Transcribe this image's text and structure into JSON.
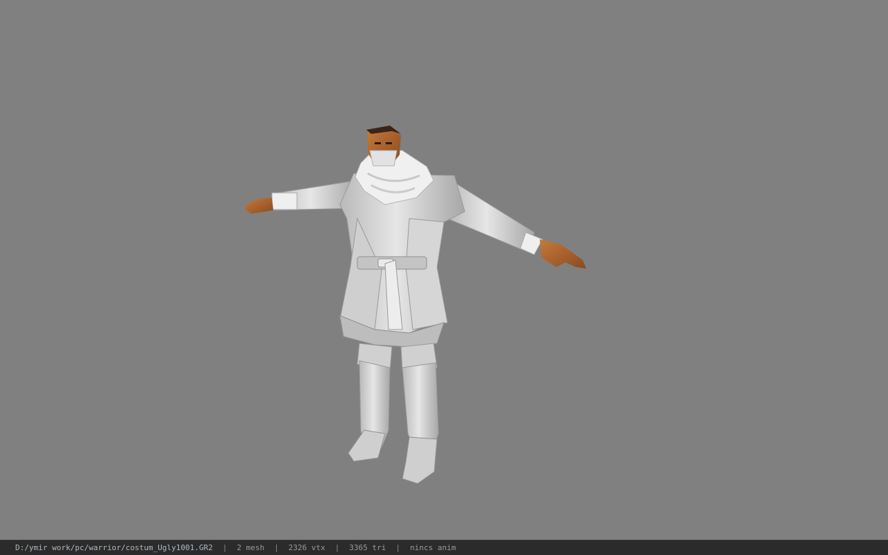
{
  "viewport": {
    "background": "#808080",
    "model_name": "costum_Ugly1001"
  },
  "status_bar": {
    "file_path": "D:/ymir work/pc/warrior/costum_Ugly1001.GR2",
    "separator": "|",
    "mesh_count": "2 mesh",
    "vertex_count": "2326 vtx",
    "triangle_count": "3365 tri",
    "animation": "nincs anim"
  },
  "colors": {
    "cloth": "#d8d8d8",
    "cloth_shadow": "#a9a9a9",
    "skin": "#b8682c",
    "hair": "#3a2418",
    "status_bg": "#2b2b2b"
  }
}
